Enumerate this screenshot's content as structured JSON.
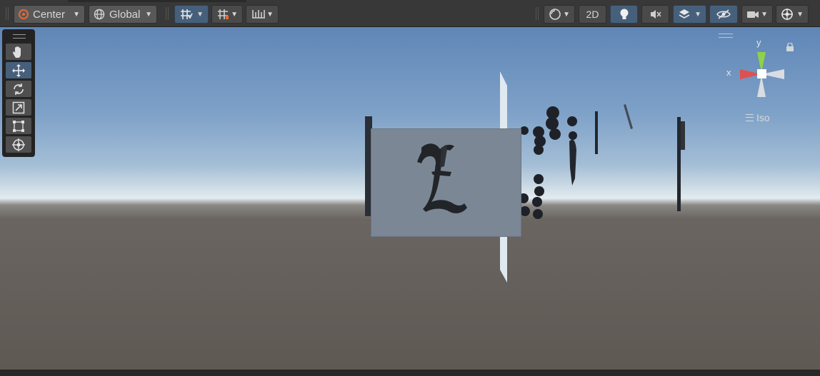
{
  "toolbar": {
    "pivot_mode": "Center",
    "pivot_rotation": "Global",
    "mode_2d": "2D"
  },
  "gizmo": {
    "y_label": "y",
    "x_label": "x",
    "projection": "Iso"
  },
  "colors": {
    "toolbar_bg": "#383838",
    "active_blue": "#46607c",
    "gizmo_x": "#e05050",
    "gizmo_y": "#8fd24a"
  },
  "icons": {
    "palette": [
      "hand-icon",
      "move-icon",
      "rotate-icon",
      "scale-icon",
      "rect-icon",
      "transform-icon"
    ]
  }
}
